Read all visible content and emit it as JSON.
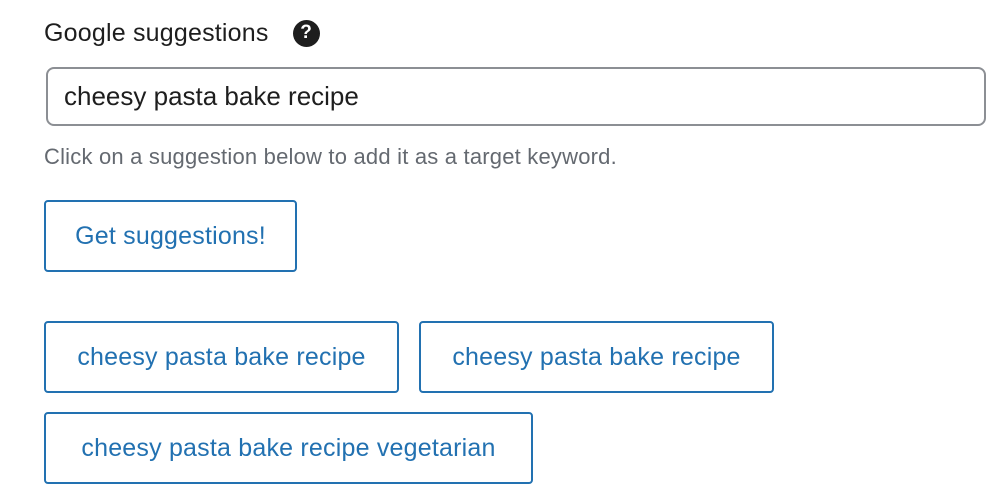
{
  "field": {
    "label": "Google suggestions",
    "help_icon": "question-mark-icon",
    "help_glyph": "?",
    "input_value": "cheesy pasta bake recipe",
    "hint": "Click on a suggestion below to add it as a target keyword."
  },
  "actions": {
    "get_suggestions_label": "Get suggestions!"
  },
  "suggestions": [
    {
      "label": "cheesy pasta bake recipe"
    },
    {
      "label": "cheesy pasta bake recipe"
    },
    {
      "label": "cheesy pasta bake recipe vegetarian"
    }
  ],
  "colors": {
    "accent": "#2271b1",
    "text": "#1e1e1e",
    "muted": "#646970",
    "input_border": "#8c8f94"
  }
}
